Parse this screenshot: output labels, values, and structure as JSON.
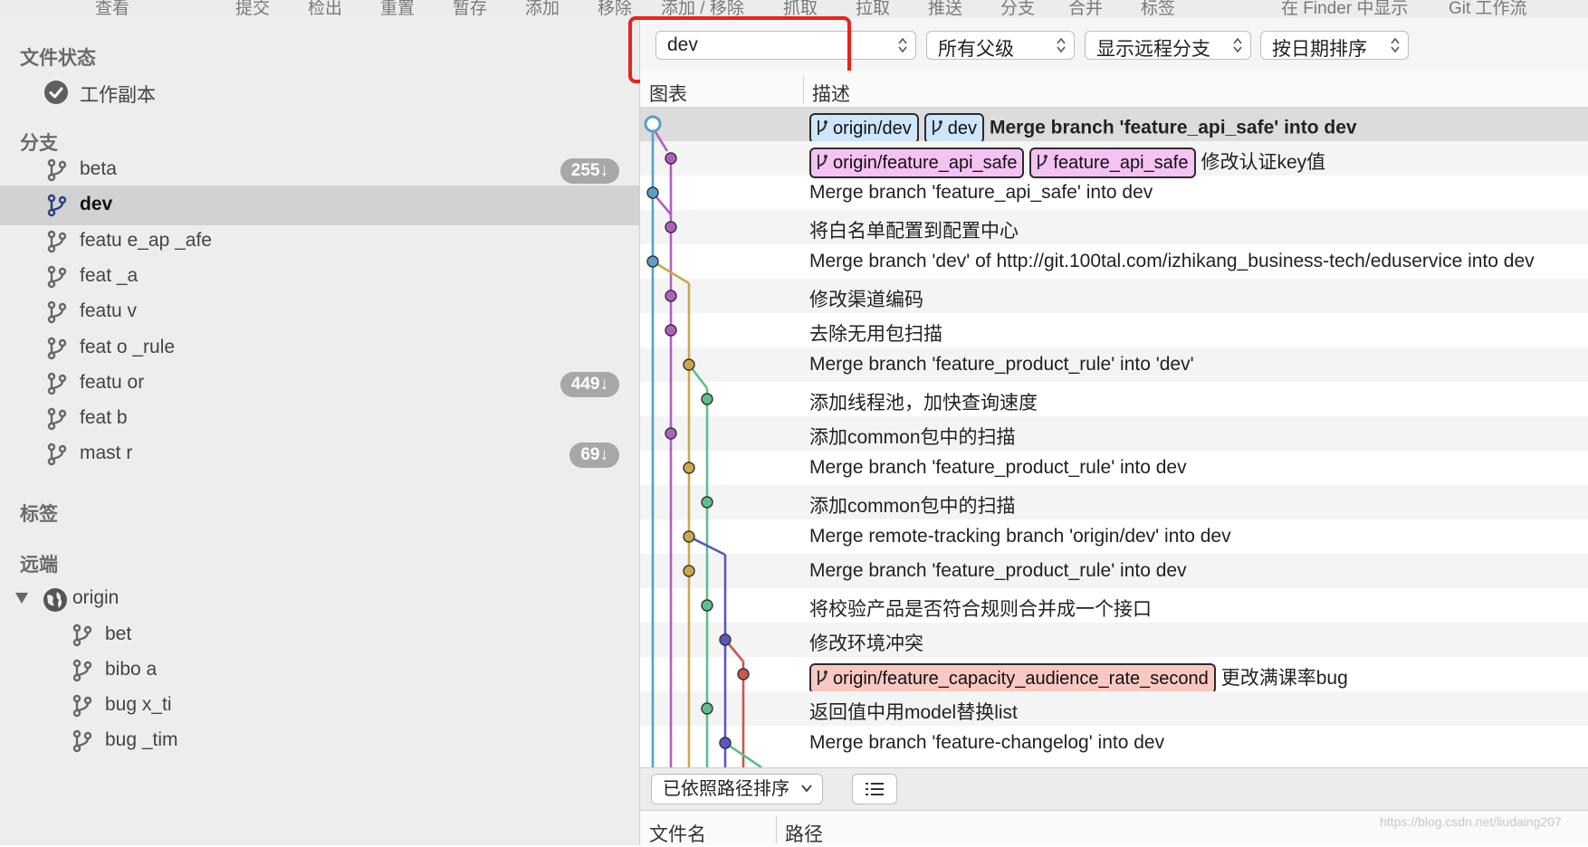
{
  "toolbar": {
    "items": [
      "查看",
      "提交",
      "检出",
      "重置",
      "暂存",
      "添加",
      "移除",
      "添加 / 移除",
      "抓取",
      "拉取",
      "推送",
      "分支",
      "合并",
      "标签",
      "在 Finder 中显示",
      "Git 工作流"
    ]
  },
  "sidebar": {
    "file_status_title": "文件状态",
    "working_copy": "工作副本",
    "branches_title": "分支",
    "branches": [
      {
        "label": "beta",
        "badge": "255↓"
      },
      {
        "label": "dev",
        "badge": "",
        "selected": true
      },
      {
        "label": "featu e_ap _afe",
        "badge": ""
      },
      {
        "label": "feat _a",
        "badge": ""
      },
      {
        "label": "featu  v",
        "badge": ""
      },
      {
        "label": "feat  o _rule",
        "badge": ""
      },
      {
        "label": "featu  or",
        "badge": "449↓"
      },
      {
        "label": "feat b",
        "badge": ""
      },
      {
        "label": "mast r",
        "badge": "69↓"
      }
    ],
    "tags_title": "标签",
    "remotes_title": "远端",
    "remote_name": "origin",
    "remote_branches": [
      "bet",
      "bibo a",
      "bug x_ti",
      "bug _tim"
    ]
  },
  "filter": {
    "branch": "dev",
    "parents": "所有父级",
    "remote": "显示远程分支",
    "order": "按日期排序"
  },
  "columns": {
    "graph": "图表",
    "description": "描述"
  },
  "commits": [
    {
      "refs": [
        {
          "label": "origin/dev",
          "style": "blue"
        },
        {
          "label": "dev",
          "style": "blue"
        }
      ],
      "desc": "Merge branch 'feature_api_safe' into dev",
      "bold": true
    },
    {
      "refs": [
        {
          "label": "origin/feature_api_safe",
          "style": "pink"
        },
        {
          "label": "feature_api_safe",
          "style": "pink"
        }
      ],
      "desc": "修改认证key值"
    },
    {
      "refs": [],
      "desc": "Merge branch 'feature_api_safe' into dev"
    },
    {
      "refs": [],
      "desc": "将白名单配置到配置中心"
    },
    {
      "refs": [],
      "desc": "Merge branch 'dev' of http://git.100tal.com/izhikang_business-tech/eduservice into dev"
    },
    {
      "refs": [],
      "desc": "修改渠道编码"
    },
    {
      "refs": [],
      "desc": "去除无用包扫描"
    },
    {
      "refs": [],
      "desc": "Merge branch 'feature_product_rule' into 'dev'"
    },
    {
      "refs": [],
      "desc": "添加线程池，加快查询速度"
    },
    {
      "refs": [],
      "desc": "添加common包中的扫描"
    },
    {
      "refs": [],
      "desc": "Merge branch 'feature_product_rule' into dev"
    },
    {
      "refs": [],
      "desc": "添加common包中的扫描"
    },
    {
      "refs": [],
      "desc": "Merge remote-tracking branch 'origin/dev' into dev"
    },
    {
      "refs": [],
      "desc": "Merge branch 'feature_product_rule' into dev"
    },
    {
      "refs": [],
      "desc": "将校验产品是否符合规则合并成一个接口"
    },
    {
      "refs": [],
      "desc": "修改环境冲突"
    },
    {
      "refs": [
        {
          "label": "origin/feature_capacity_audience_rate_second",
          "style": "red"
        }
      ],
      "desc": "更改满课率bug"
    },
    {
      "refs": [],
      "desc": "返回值中用model替换list"
    },
    {
      "refs": [],
      "desc": "Merge branch 'feature-changelog' into dev"
    }
  ],
  "bottom": {
    "sort_label": "已依照路径排序",
    "file_col": "文件名",
    "path_col": "路径"
  },
  "watermark": "https://blog.csdn.net/liudaing207",
  "colors": {
    "lane_blue": "#5a9fc7",
    "lane_purple": "#b05fbf",
    "lane_gold": "#c9a94a",
    "lane_green": "#5fbf8c",
    "lane_indigo": "#5b57c2",
    "lane_red": "#c9584b",
    "highlight": "#e8231d"
  }
}
